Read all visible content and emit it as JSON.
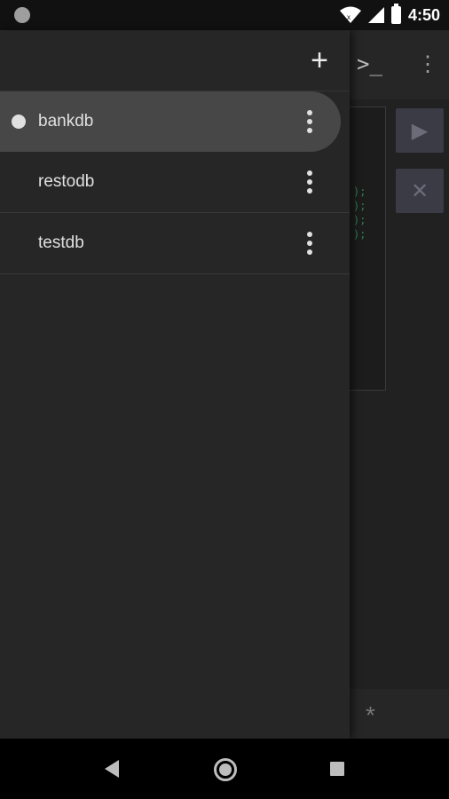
{
  "status_bar": {
    "time": "4:50",
    "icons": [
      "notification-circle-icon",
      "wifi-icon",
      "signal-icon",
      "battery-icon"
    ]
  },
  "drawer": {
    "add_button_icon": "plus-icon",
    "items": [
      {
        "label": "bankdb",
        "active": true
      },
      {
        "label": "restodb",
        "active": false
      },
      {
        "label": "testdb",
        "active": false
      }
    ]
  },
  "background_app": {
    "toolbar_icons": [
      "terminal-icon",
      "overflow-menu-icon"
    ],
    "code_glyphs": ");\n);\n);\n);",
    "run_button_icon": "play-icon",
    "clear_button_icon": "close-icon",
    "bottom_icon": "asterisk-icon"
  },
  "nav_bar": {
    "icons": [
      "back-icon",
      "home-icon",
      "recents-icon"
    ]
  }
}
